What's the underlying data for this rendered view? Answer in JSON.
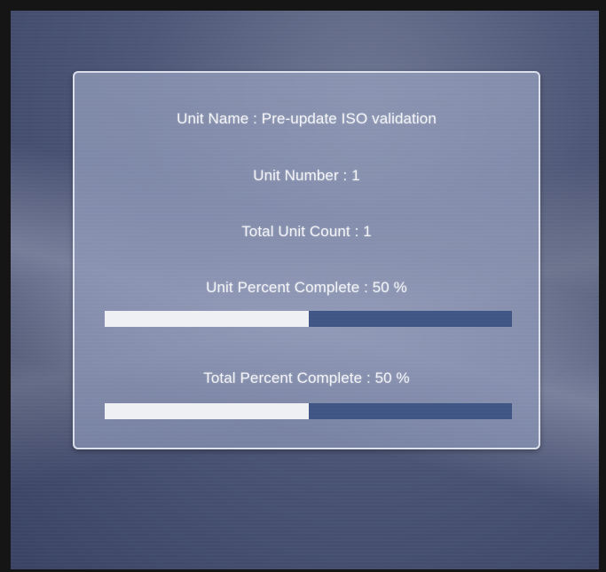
{
  "dialog": {
    "unit_name": "Unit Name : Pre-update ISO validation",
    "unit_number": "Unit Number : 1",
    "total_unit_count": "Total Unit Count : 1",
    "unit_percent_label": "Unit Percent Complete : 50 %",
    "unit_percent_value": 50,
    "total_percent_label": "Total Percent Complete : 50 %",
    "total_percent_value": 50
  },
  "colors": {
    "progress_fill": "#eef0f4",
    "progress_track": "#3e5585",
    "text": "#f3f4f8"
  }
}
